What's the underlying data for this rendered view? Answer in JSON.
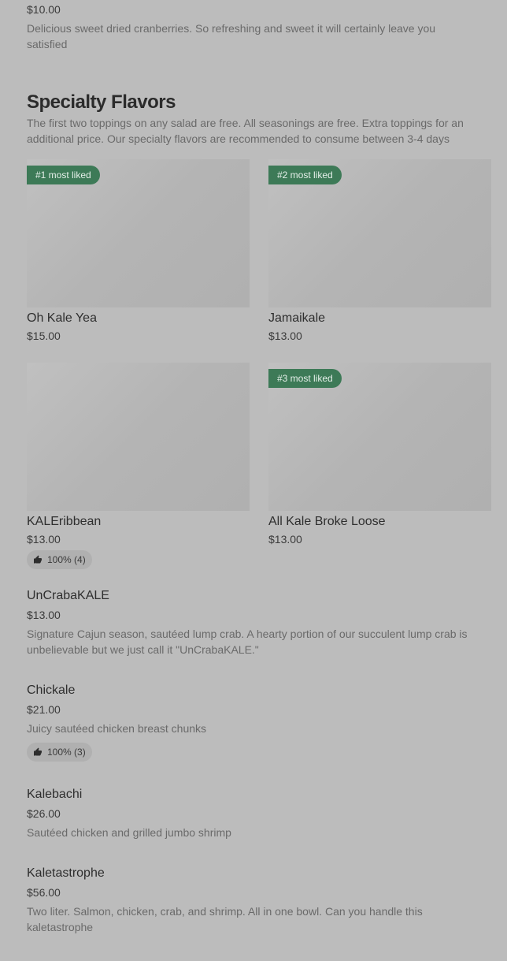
{
  "top_item": {
    "price": "$10.00",
    "description": "Delicious sweet dried cranberries. So refreshing and sweet it will certainly leave you satisfied"
  },
  "section": {
    "title": "Specialty Flavors",
    "description": "The first two toppings on any salad are free. All seasonings are free. Extra toppings for an additional price. Our specialty flavors are recommended to consume between 3-4 days"
  },
  "cards": [
    {
      "name": "Oh Kale Yea",
      "price": "$15.00",
      "badge": "#1 most liked"
    },
    {
      "name": "Jamaikale",
      "price": "$13.00",
      "badge": "#2 most liked"
    },
    {
      "name": "KALEribbean",
      "price": "$13.00",
      "rating": "100% (4)"
    },
    {
      "name": "All Kale Broke Loose",
      "price": "$13.00",
      "badge": "#3 most liked"
    }
  ],
  "items": [
    {
      "name": "UnCrabaKALE",
      "price": "$13.00",
      "description": "Signature Cajun season, sautéed lump crab. A hearty portion of our succulent lump crab is unbelievable but we just call it \"UnCrabaKALE.\""
    },
    {
      "name": "Chickale",
      "price": "$21.00",
      "description": "Juicy sautéed chicken breast chunks",
      "rating": "100% (3)"
    },
    {
      "name": "Kalebachi",
      "price": "$26.00",
      "description": "Sautéed chicken and grilled jumbo shrimp"
    },
    {
      "name": "Kaletastrophe",
      "price": "$56.00",
      "description": "Two liter. Salmon, chicken, crab, and shrimp. All in one bowl. Can you handle this kaletastrophe"
    }
  ],
  "icons": {
    "rating": "thumbs-up-icon"
  },
  "colors": {
    "badge_bg": "#3d7a57",
    "background": "#bcbcbc"
  }
}
